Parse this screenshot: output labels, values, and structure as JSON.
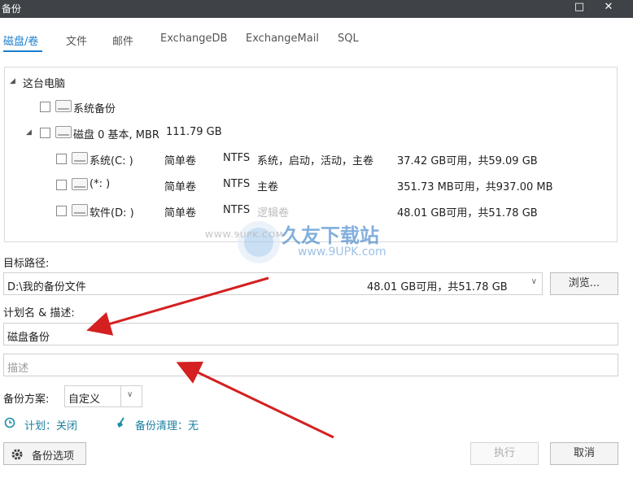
{
  "window": {
    "title": "备份",
    "maximize_glyph": "□",
    "close_glyph": "✕"
  },
  "tabs": [
    "磁盘/卷",
    "文件",
    "邮件",
    "ExchangeDB",
    "ExchangeMail",
    "SQL"
  ],
  "tree": {
    "root": "这台电脑",
    "system_backup": "系统备份",
    "disk0": {
      "name": "磁盘 0 基本, MBR",
      "size": "111.79 GB"
    },
    "partitions": [
      {
        "name": "系统(C: )",
        "type": "简单卷",
        "fs": "NTFS",
        "flags": "系统，启动，活动，主卷",
        "space": "37.42 GB可用，共59.09 GB"
      },
      {
        "name": "(*: )",
        "type": "简单卷",
        "fs": "NTFS",
        "flags": "主卷",
        "space": "351.73 MB可用，共937.00 MB"
      },
      {
        "name": "软件(D: )",
        "type": "简单卷",
        "fs": "NTFS",
        "flags": "逻辑卷",
        "space": "48.01 GB可用，共51.78 GB"
      }
    ]
  },
  "target": {
    "label": "目标路径:",
    "path": "D:\\我的备份文件",
    "space": "48.01 GB可用，共51.78 GB",
    "browse": "浏览..."
  },
  "plan": {
    "label": "计划名 & 描述:",
    "name": "磁盘备份",
    "desc_placeholder": "描述"
  },
  "scheme": {
    "label": "备份方案:",
    "value": "自定义"
  },
  "schedule": {
    "label": "计划：关闭"
  },
  "cleanup": {
    "label": "备份清理：无"
  },
  "footer": {
    "options": "备份选项",
    "execute": "执行",
    "cancel": "取消"
  },
  "watermark": {
    "brand": "久友下载站",
    "site": "www.9UPK.com",
    "small": "WWW.9UPK.COM"
  },
  "colors": {
    "accent": "#1a7fd0",
    "titlebar": "#3f4347",
    "arrow": "#d42020"
  }
}
